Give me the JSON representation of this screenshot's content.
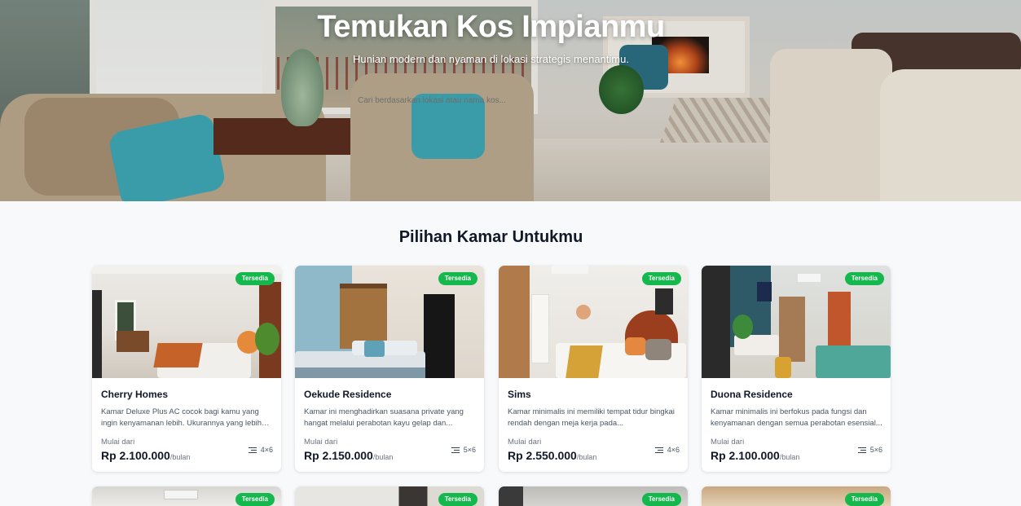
{
  "hero": {
    "title": "Temukan Kos Impianmu",
    "subtitle": "Hunian modern dan nyaman di lokasi strategis menantimu.",
    "search_placeholder": "Cari berdasarkan lokasi atau nama kos..."
  },
  "section": {
    "title": "Pilihan Kamar Untukmu"
  },
  "colors": {
    "badge": "#14b84c",
    "accent_teal": "#3fa6b4"
  },
  "cards": [
    {
      "badge": "Tersedia",
      "name": "Cherry Homes",
      "description": "Kamar Deluxe Plus AC cocok bagi kamu yang ingin kenyamanan lebih. Ukurannya yang lebih luas...",
      "from_label": "Mulai dari",
      "price": "Rp 2.100.000",
      "unit": "/bulan",
      "size": "4×6",
      "size_icon": "room-size-icon"
    },
    {
      "badge": "Tersedia",
      "name": "Oekude Residence",
      "description": "Kamar ini menghadirkan suasana private yang hangat melalui perabotan kayu gelap dan...",
      "from_label": "Mulai dari",
      "price": "Rp 2.150.000",
      "unit": "/bulan",
      "size": "5×6",
      "size_icon": "room-size-icon"
    },
    {
      "badge": "Tersedia",
      "name": "Sims",
      "description": "Kamar minimalis ini memiliki tempat tidur bingkai rendah dengan meja kerja pada...",
      "from_label": "Mulai dari",
      "price": "Rp 2.550.000",
      "unit": "/bulan",
      "size": "4×6",
      "size_icon": "room-size-icon"
    },
    {
      "badge": "Tersedia",
      "name": "Duona Residence",
      "description": "Kamar minimalis ini berfokus pada fungsi dan kenyamanan dengan semua perabotan esensial...",
      "from_label": "Mulai dari",
      "price": "Rp 2.100.000",
      "unit": "/bulan",
      "size": "5×6",
      "size_icon": "room-size-icon"
    }
  ],
  "next_row_badges": [
    "Tersedia",
    "Tersedia",
    "Tersedia",
    "Tersedia"
  ]
}
